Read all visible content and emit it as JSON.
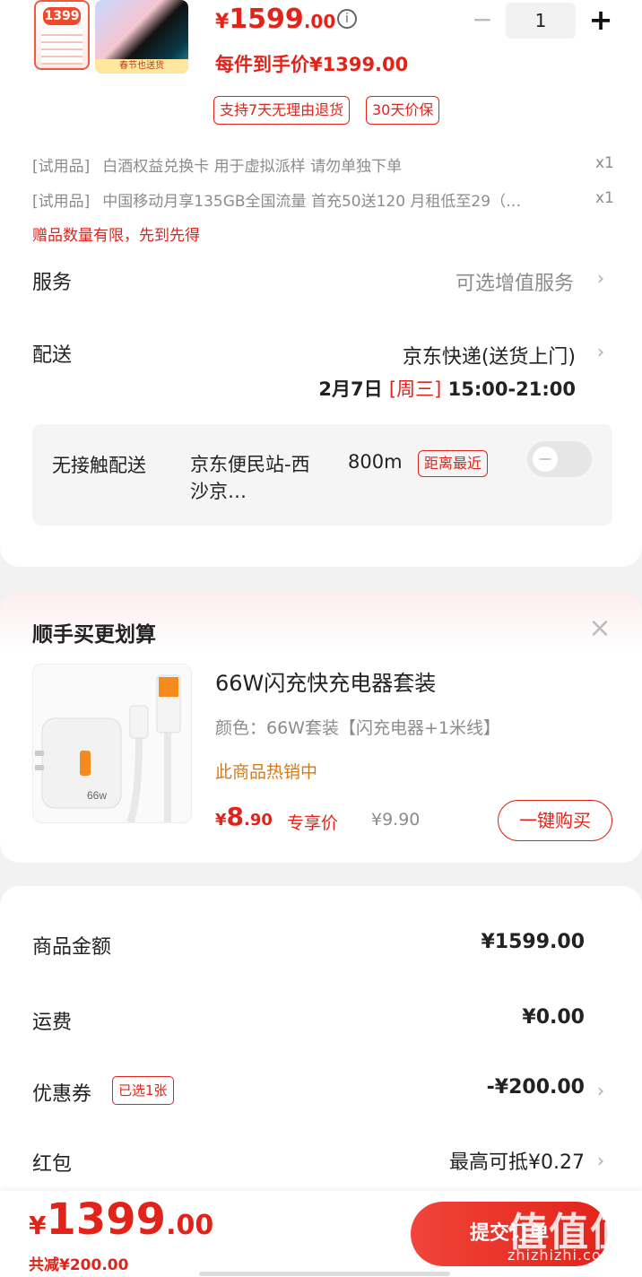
{
  "product": {
    "thumb_tag": "1399",
    "thumb_ribbon": "春节也送货",
    "price_yen": "¥",
    "price_int": "1599",
    "price_dec": ".00",
    "info_icon": "i",
    "quantity": "1",
    "minus": "−",
    "plus": "+",
    "hand_price": "每件到手价¥1399.00",
    "badges": [
      "支持7天无理由退货",
      "30天价保"
    ]
  },
  "gifts": [
    {
      "tag": "[试用品]",
      "name": "白酒权益兑换卡 用于虚拟派样 请勿单独下单",
      "qty": "x1"
    },
    {
      "tag": "[试用品]",
      "name": "中国移动月享135GB全国流量 首充50送120 月租低至29（…",
      "qty": "x1"
    }
  ],
  "gift_note": "赠品数量有限，先到先得",
  "service": {
    "label": "服务",
    "value": "可选增值服务"
  },
  "delivery": {
    "label": "配送",
    "method": "京东快递(送货上门)",
    "date": "2月7日",
    "weekday": "[周三]",
    "time": "15:00-21:00",
    "contactless": "无接触配送",
    "station": "京东便民站-西沙京…",
    "distance": "800m",
    "distance_tag": "距离最近",
    "toggle_on": false
  },
  "upsell": {
    "title": "顺手买更划算",
    "close": "×",
    "name": "66W闪充快充电器套装",
    "spec": "颜色：66W套装【闪充电器+1米线】",
    "hot": "此商品热销中",
    "price_yen": "¥",
    "price_int": "8",
    "price_dec": ".90",
    "price_label": "专享价",
    "orig_price": "¥9.90",
    "buy_label": "一键购买",
    "charger_text": "66w"
  },
  "summary": {
    "goods_label": "商品金额",
    "goods_value": "¥1599.00",
    "shipping_label": "运费",
    "shipping_value": "¥0.00",
    "coupon_label": "优惠券",
    "coupon_tag": "已选1张",
    "coupon_value": "-¥200.00",
    "redpacket_label": "红包",
    "redpacket_value": "最高可抵¥0.27"
  },
  "footer": {
    "total_yen": "¥",
    "total_int": "1399",
    "total_dec": ".00",
    "saved": "共减¥200.00",
    "submit": "提交订单",
    "watermark": "值值值",
    "watermark_url": "zhizhizhi.com"
  },
  "chevron": "›",
  "colors": {
    "accent": "#e2231a",
    "muted": "#8c8c8c",
    "background": "#f2f2f2"
  }
}
